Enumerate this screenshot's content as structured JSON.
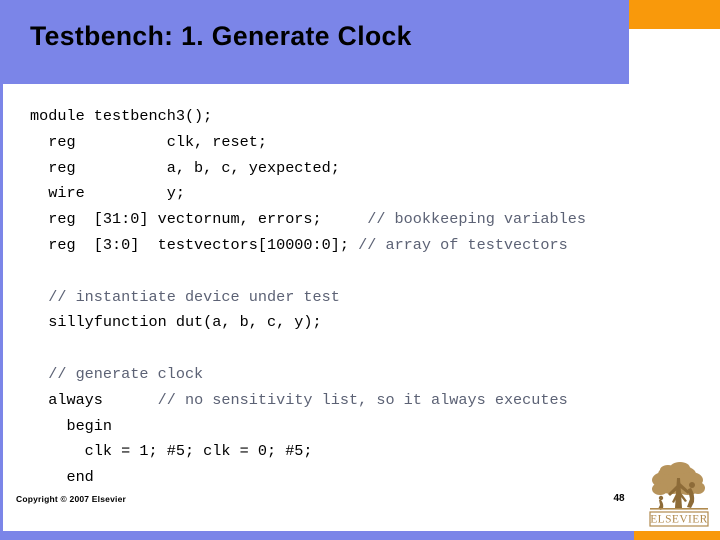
{
  "slide": {
    "title": "Testbench: 1. Generate Clock",
    "page_number": "48",
    "copyright": "Copyright © 2007 Elsevier",
    "colors": {
      "header_blue": "#7b85e8",
      "accent_orange": "#f9990b",
      "code_text": "#000000",
      "comment_text": "#5c6275",
      "logo_gold": "#d4a24a"
    }
  },
  "code": {
    "lines": [
      {
        "text": "module testbench3();",
        "comment": false
      },
      {
        "text": "  reg          clk, reset;",
        "comment": false
      },
      {
        "text": "  reg          a, b, c, yexpected;",
        "comment": false
      },
      {
        "text": "  wire         y;",
        "comment": false
      },
      {
        "text": "  reg  [31:0] vectornum, errors;     // bookkeeping variables",
        "comment": false
      },
      {
        "text": "  reg  [3:0]  testvectors[10000:0]; // array of testvectors",
        "comment": false
      },
      {
        "text": "",
        "comment": false
      },
      {
        "text": "  // instantiate device under test",
        "comment": true
      },
      {
        "text": "  sillyfunction dut(a, b, c, y);",
        "comment": false
      },
      {
        "text": "",
        "comment": false
      },
      {
        "text": "  // generate clock",
        "comment": true
      },
      {
        "text": "  always      // no sensitivity list, so it always executes",
        "comment": false
      },
      {
        "text": "    begin",
        "comment": false
      },
      {
        "text": "      clk = 1; #5; clk = 0; #5;",
        "comment": false
      },
      {
        "text": "    end",
        "comment": false
      }
    ]
  },
  "logo": {
    "wordmark": "ELSEVIER",
    "icon_name": "elsevier-tree-logo"
  }
}
